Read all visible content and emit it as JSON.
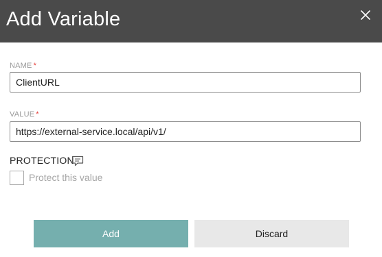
{
  "dialog": {
    "title": "Add Variable",
    "close_icon": "close-icon"
  },
  "name_field": {
    "label": "NAME",
    "required_mark": "*",
    "value": "ClientURL"
  },
  "value_field": {
    "label": "VALUE",
    "required_mark": "*",
    "value": "https://external-service.local/api/v1/"
  },
  "protection": {
    "label": "PROTECTION",
    "icon": "comment-icon",
    "checkbox_label": "Protect this value",
    "checked": false
  },
  "buttons": {
    "add_label": "Add",
    "discard_label": "Discard"
  },
  "colors": {
    "header_bg": "#4a4a4a",
    "primary_button": "#75afae",
    "secondary_button": "#e8e8e8",
    "required": "#e53935"
  }
}
